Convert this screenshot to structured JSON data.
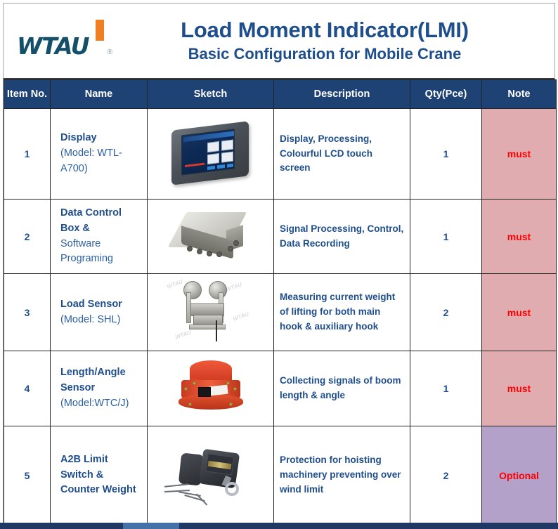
{
  "header": {
    "logo_text": "WTAU",
    "logo_registered": "®",
    "title": "Load Moment Indicator(LMI)",
    "subtitle": "Basic Configuration for Mobile Crane",
    "title_color": "#1f4e8c",
    "logo_color": "#15506b",
    "logo_accent_color": "#ee7f22"
  },
  "table": {
    "header_bg": "#1f4274",
    "columns": [
      {
        "key": "item",
        "label": "Item No."
      },
      {
        "key": "name",
        "label": "Name"
      },
      {
        "key": "sketch",
        "label": "Sketch"
      },
      {
        "key": "description",
        "label": "Description"
      },
      {
        "key": "qty",
        "label": "Qty(Pce)"
      },
      {
        "key": "note",
        "label": "Note"
      }
    ],
    "rows": [
      {
        "item": "1",
        "name_line1": "Display",
        "name_line2": "(Model: WTL-A700)",
        "sketch_name": "display-touchscreen-image",
        "description": "Display, Processing, Colourful LCD touch screen",
        "qty": "1",
        "note": "must",
        "note_bg": "#e0acb0",
        "note_color": "#ff0000"
      },
      {
        "item": "2",
        "name_line1": "Data Control Box &",
        "name_line2": "Software Programing",
        "sketch_name": "data-control-box-image",
        "description": "Signal Processing, Control, Data Recording",
        "qty": "1",
        "note": "must",
        "note_bg": "#e0acb0",
        "note_color": "#ff0000"
      },
      {
        "item": "3",
        "name_line1": "Load Sensor",
        "name_line2": "(Model: SHL)",
        "sketch_name": "load-sensor-image",
        "description": "Measuring current weight of lifting for both main hook & auxiliary hook",
        "qty": "2",
        "note": "must",
        "note_bg": "#e0acb0",
        "note_color": "#ff0000"
      },
      {
        "item": "4",
        "name_line1": "Length/Angle Sensor",
        "name_line2": "(Model:WTC/J)",
        "sketch_name": "length-angle-sensor-image",
        "description": "Collecting signals of boom length & angle",
        "qty": "1",
        "note": "must",
        "note_bg": "#e0acb0",
        "note_color": "#ff0000"
      },
      {
        "item": "5",
        "name_line1": "A2B Limit Switch &",
        "name_line2": "Counter Weight",
        "sketch_name": "a2b-limit-switch-image",
        "description": "Protection for hoisting machinery preventing over wind limit",
        "qty": "2",
        "note": "Optional",
        "note_bg": "#b3a1c9",
        "note_color": "#ff0000"
      }
    ]
  },
  "watermarks": {
    "load_sensor": [
      "WTAU",
      "WTAU",
      "WTAU",
      "WTAU"
    ]
  }
}
